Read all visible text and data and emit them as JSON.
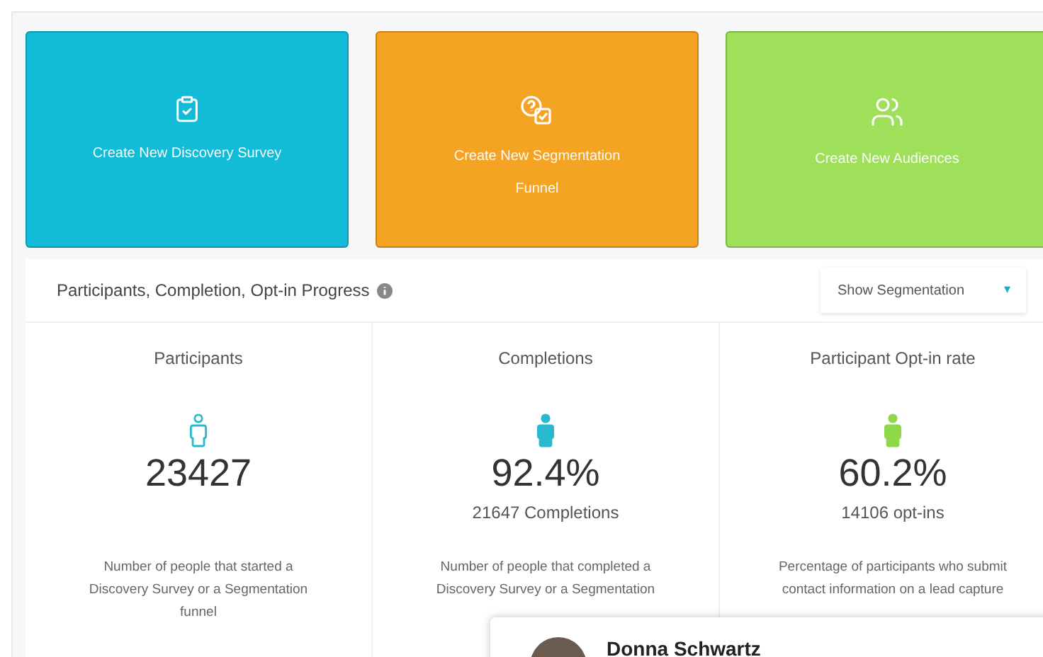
{
  "tiles": [
    {
      "kind": "survey",
      "label": "Create New Discovery Survey",
      "color": "#12bcd8"
    },
    {
      "kind": "funnel",
      "label": "Create New Segmentation Funnel",
      "color": "#f4a322"
    },
    {
      "kind": "audiences",
      "label": "Create New Audiences",
      "color": "#9fe05a"
    }
  ],
  "progress": {
    "title": "Participants, Completion, Opt-in Progress",
    "dropdown": {
      "label": "Show Segmentation",
      "caret": "▾"
    },
    "stats": [
      {
        "label": "Participants",
        "kind": "outline",
        "color": "#29b9cf",
        "value": "23427",
        "description": "Number of people that started a Discovery Survey or a Segmentation funnel"
      },
      {
        "label": "Completions",
        "kind": "filled",
        "color": "#29b9cf",
        "value": "92.4%",
        "detail": "21647 Completions",
        "description": "Number of people that completed a Discovery Survey or a Segmentation"
      },
      {
        "label": "Participant Opt-in rate",
        "kind": "filled",
        "color": "#8fd84a",
        "value": "60.2%",
        "detail": "14106 opt-ins",
        "description": "Percentage of participants who submit contact information on a lead capture"
      }
    ]
  },
  "popup": {
    "name": "Donna Schwartz"
  }
}
